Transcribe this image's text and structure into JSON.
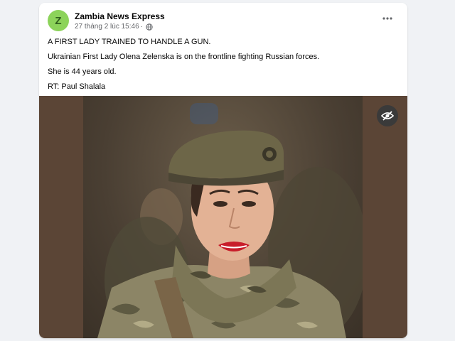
{
  "post": {
    "page_name": "Zambia News Express",
    "avatar_letter": "Z",
    "timestamp": "27 tháng 2 lúc 15:46",
    "separator": "·",
    "lines": [
      "A FIRST LADY TRAINED TO HANDLE A GUN.",
      "Ukrainian First Lady Olena Zelenska is on the frontline fighting Russian forces.",
      "She is 44 years old.",
      "RT: Paul Shalala"
    ]
  },
  "colors": {
    "avatar_bg": "#8cd35a",
    "page_bg": "#f0f2f5",
    "media_bg": "#5b4536"
  },
  "icons": {
    "privacy": "globe-icon",
    "options": "more-horizontal-icon",
    "hide": "eye-slash-icon"
  }
}
